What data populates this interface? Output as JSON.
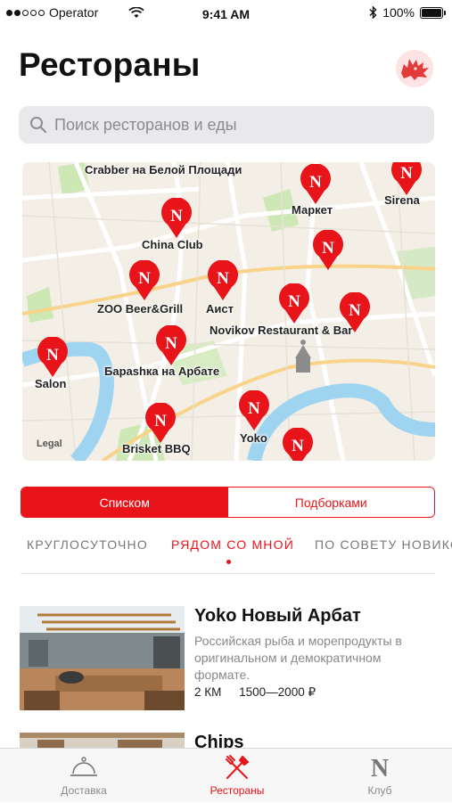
{
  "status": {
    "carrier": "Operator",
    "time": "9:41 AM",
    "battery": "100%"
  },
  "header": {
    "title": "Рестораны",
    "avatar_icon": "direwolf-emblem-icon"
  },
  "search": {
    "placeholder": "Поиск ресторанов и еды"
  },
  "map": {
    "legal": "Legal",
    "pins": [
      "Crabber на Белой Площади",
      "Маркет",
      "Sirena",
      "China Club",
      "ZOO Beer&Grill",
      "Аист",
      "Novikov Restaurant & Bar",
      "Salon",
      "Барashка на Арбате",
      "Brisket BBQ",
      "Yoko"
    ]
  },
  "segments": {
    "list": "Списком",
    "collections": "Подборками"
  },
  "categories": [
    "КРУГЛОСУТОЧНО",
    "РЯДОМ СО МНОЙ",
    "ПО СОВЕТУ НОВИКО"
  ],
  "restaurants": [
    {
      "name": "Yoko Новый Арбат",
      "description": "Российская рыба и морепродукты в оригинальном и демократичном формате.",
      "distance": "2 КМ",
      "price": "1500—2000 ₽"
    },
    {
      "name": "Chips",
      "description": "",
      "distance": "",
      "price": ""
    }
  ],
  "tabs": [
    {
      "label": "Доставка",
      "icon": "cloche-icon"
    },
    {
      "label": "Рестораны",
      "icon": "fork-knife-icon"
    },
    {
      "label": "Клуб",
      "icon": "n-logo-icon"
    }
  ],
  "colors": {
    "accent": "#e8141a",
    "map_land": "#f3efe6",
    "map_water": "#9fd4f0",
    "map_park": "#cde7b5"
  }
}
